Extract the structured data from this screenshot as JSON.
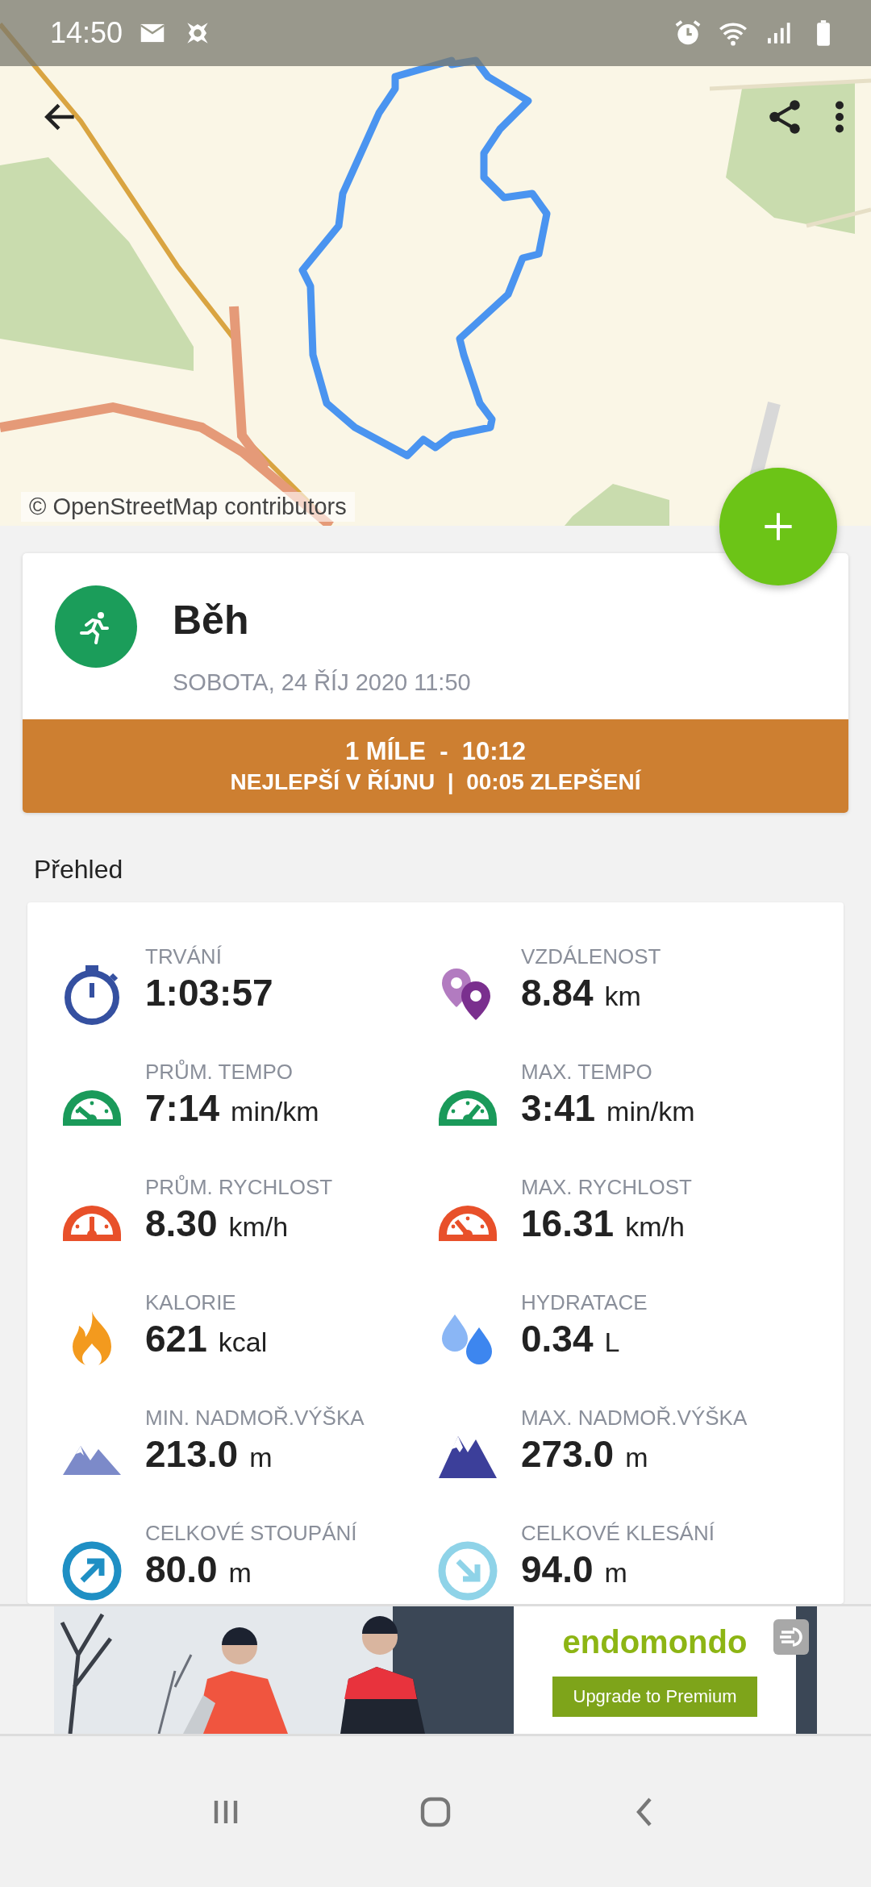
{
  "status_bar": {
    "time": "14:50"
  },
  "map": {
    "attribution": "© OpenStreetMap contributors"
  },
  "activity": {
    "title": "Běh",
    "date": "SOBOTA, 24 ŘÍJ 2020 11:50",
    "record_line": "1 MÍLE  -  10:12",
    "record_detail": "NEJLEPŠÍ V ŘÍJNU  |  00:05 ZLEPŠENÍ"
  },
  "section_title": "Přehled",
  "stats": [
    {
      "kind": "duration",
      "label": "TRVÁNÍ",
      "value": "1:03:57"
    },
    {
      "kind": "distance",
      "label": "VZDÁLENOST",
      "value": "8.84",
      "unit": "km"
    },
    {
      "kind": "pace_avg",
      "label": "PRŮM. TEMPO",
      "value": "7:14",
      "unit": "min/km"
    },
    {
      "kind": "pace_max",
      "label": "MAX. TEMPO",
      "value": "3:41",
      "unit": "min/km"
    },
    {
      "kind": "speed_avg",
      "label": "PRŮM. RYCHLOST",
      "value": "8.30",
      "unit": "km/h"
    },
    {
      "kind": "speed_max",
      "label": "MAX. RYCHLOST",
      "value": "16.31",
      "unit": "km/h"
    },
    {
      "kind": "calories",
      "label": "KALORIE",
      "value": "621",
      "unit": "kcal"
    },
    {
      "kind": "hydration",
      "label": "HYDRATACE",
      "value": "0.34",
      "unit": "L"
    },
    {
      "kind": "elevation_min",
      "label": "MIN. NADMOŘ.VÝŠKA",
      "value": "213.0",
      "unit": "m"
    },
    {
      "kind": "elevation_max",
      "label": "MAX. NADMOŘ.VÝŠKA",
      "value": "273.0",
      "unit": "m"
    },
    {
      "kind": "ascent",
      "label": "CELKOVÉ STOUPÁNÍ",
      "value": "80.0",
      "unit": "m"
    },
    {
      "kind": "descent",
      "label": "CELKOVÉ KLESÁNÍ",
      "value": "94.0",
      "unit": "m"
    }
  ],
  "ad": {
    "logo": "endomondo",
    "button": "Upgrade to Premium"
  }
}
